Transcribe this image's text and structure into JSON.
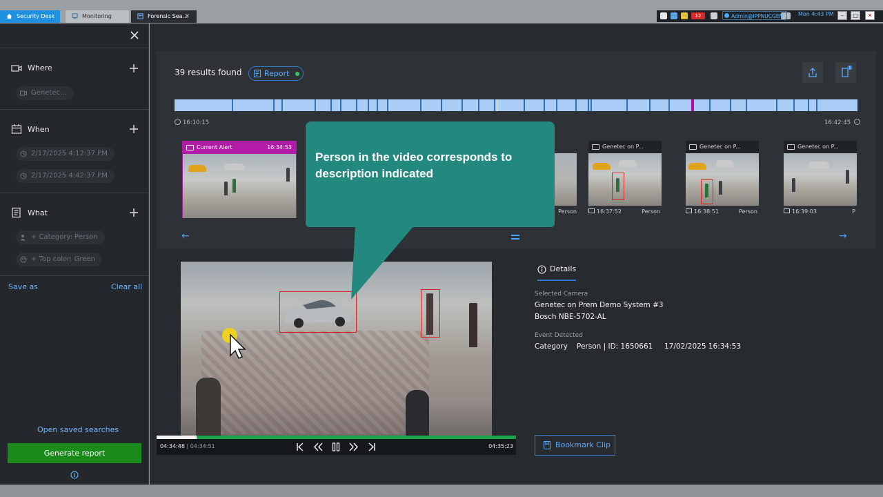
{
  "tabs": {
    "security_desk": "Security Desk",
    "monitoring": "Monitoring",
    "forensic": "Forensic Sea...",
    "forensic_close": "✕"
  },
  "tray": {
    "badge": "12",
    "user": "Admin@IPPNUCGEN",
    "clock": "Mon 4:43 PM"
  },
  "left_panel": {
    "where": {
      "title": "Where",
      "chip": "Genetec..."
    },
    "when": {
      "title": "When",
      "start": "2/17/2025 4:12:37 PM",
      "end": "2/17/2025 4:42:37 PM"
    },
    "what": {
      "title": "What",
      "category": "+ Category: Person",
      "color": "+ Top color: Green"
    },
    "save_as": "Save as",
    "clear_all": "Clear all",
    "open_saved": "Open saved searches",
    "generate_report": "Generate report"
  },
  "results": {
    "count_text": "39 results found",
    "report_label": "Report",
    "time_start": "16:10:15",
    "time_end": "16:42:45"
  },
  "thumbnails": [
    {
      "camera": "Current Alert",
      "time_head": "16:34:53",
      "time": "",
      "type": ""
    },
    {
      "camera": "Genetec on P...",
      "time_head": "",
      "time": "16:37:52",
      "type": "Person"
    },
    {
      "camera": "Genetec on P...",
      "time_head": "",
      "time": "16:38:51",
      "type": "Person"
    },
    {
      "camera": "Genetec on P...",
      "time_head": "",
      "time": "16:39:03",
      "type": "P"
    }
  ],
  "hidden_thumb_type": "Person",
  "player": {
    "time_current": "04:34:48",
    "time_sep": " | ",
    "time_sub": "04:34:51",
    "time_end": "04:35:23"
  },
  "details": {
    "tab": "Details",
    "camera_label": "Selected Camera",
    "camera_line1": "Genetec on Prem Demo System #3",
    "camera_line2": "Bosch NBE-5702-AL",
    "event_label": "Event Detected",
    "category_key": "Category",
    "category_value": "Person | ID: 1650661",
    "event_time": "17/02/2025 16:34:53",
    "bookmark": "Bookmark Clip"
  },
  "callout": {
    "text": "Person in the video corresponds to description indicated"
  },
  "colors": {
    "accent": "#2f77c7",
    "alert": "#b21ca7",
    "callout": "#23897f",
    "generate": "#1a8a1a"
  }
}
